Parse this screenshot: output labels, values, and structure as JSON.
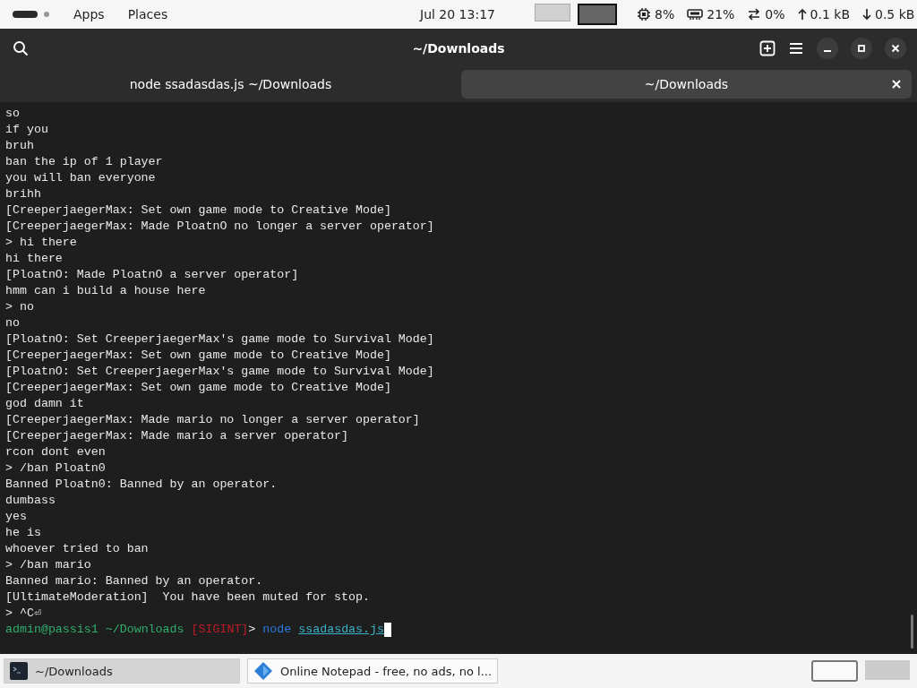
{
  "top_bar": {
    "menus": [
      "Apps",
      "Places"
    ],
    "clock": "Jul 20  13:17",
    "workspaces": [
      {
        "selected": false
      },
      {
        "selected": true
      }
    ],
    "indicators": [
      {
        "kind": "cpu",
        "text": "8%"
      },
      {
        "kind": "memory",
        "text": "21%"
      },
      {
        "kind": "swap",
        "text": "0%"
      },
      {
        "kind": "upload",
        "text": "0.1 kB"
      },
      {
        "kind": "download",
        "text": "0.5 kB"
      }
    ]
  },
  "window": {
    "title": "~/Downloads"
  },
  "tabs": [
    {
      "label": "node ssadasdas.js ~/Downloads",
      "selected": false,
      "closable": false
    },
    {
      "label": "~/Downloads",
      "selected": true,
      "closable": true
    }
  ],
  "terminal": {
    "lines": [
      "so",
      "if you",
      "bruh",
      "ban the ip of 1 player",
      "you will ban everyone",
      "brihh",
      "[CreeperjaegerMax: Set own game mode to Creative Mode]",
      "[CreeperjaegerMax: Made PloatnO no longer a server operator]",
      "> hi there",
      "hi there",
      "[PloatnO: Made PloatnO a server operator]",
      "hmm can i build a house here",
      "> no",
      "no",
      "[PloatnO: Set CreeperjaegerMax's game mode to Survival Mode]",
      "[CreeperjaegerMax: Set own game mode to Creative Mode]",
      "[PloatnO: Set CreeperjaegerMax's game mode to Survival Mode]",
      "[CreeperjaegerMax: Set own game mode to Creative Mode]",
      "god damn it",
      "[CreeperjaegerMax: Made mario no longer a server operator]",
      "[CreeperjaegerMax: Made mario a server operator]",
      "rcon dont even",
      "> /ban Ploatn0",
      "Banned Ploatn0: Banned by an operator.",
      "dumbass",
      "yes",
      "he is",
      "whoever tried to ban",
      "> /ban mario",
      "Banned mario: Banned by an operator.",
      "[UltimateModeration]  You have been muted for stop.",
      "> ^C⏎"
    ],
    "prompt": {
      "user": "admin@passis1",
      "cwd": "~/Downloads",
      "status": "[SIGINT]",
      "symbol": ">",
      "command": "node",
      "argument": "ssadasdas.js"
    }
  },
  "taskbar": {
    "tasks": [
      {
        "kind": "terminal",
        "label": "~/Downloads",
        "selected": true
      },
      {
        "kind": "browser",
        "label": "Online Notepad - free, no ads, no l...",
        "selected": false
      }
    ],
    "workspaces": [
      {
        "selected": true
      },
      {
        "selected": false
      }
    ]
  }
}
